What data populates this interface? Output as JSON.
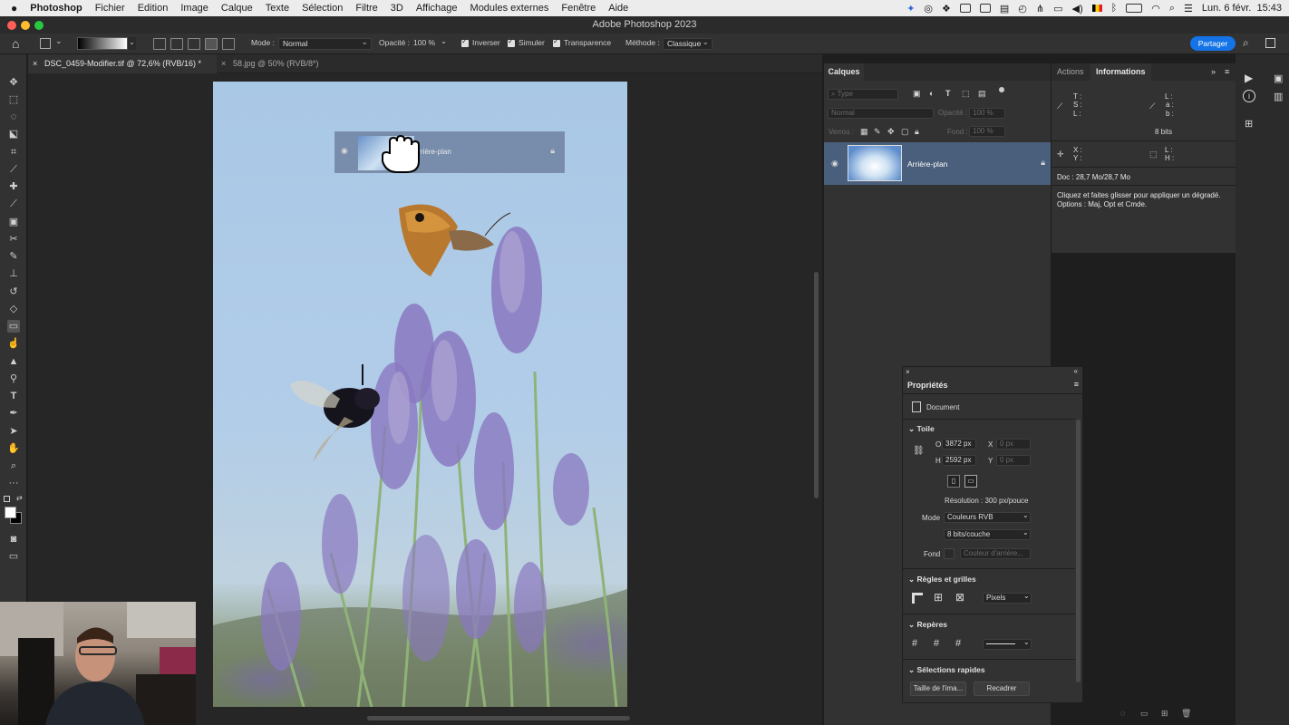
{
  "menubar": {
    "app": "Photoshop",
    "items": [
      "Fichier",
      "Edition",
      "Image",
      "Calque",
      "Texte",
      "Sélection",
      "Filtre",
      "3D",
      "Affichage",
      "Modules externes",
      "Fenêtre",
      "Aide"
    ],
    "clock": "Lun. 6 févr.  15:43"
  },
  "window": {
    "title": "Adobe Photoshop 2023"
  },
  "options": {
    "mode_label": "Mode :",
    "mode_value": "Normal",
    "opacity_label": "Opacité :",
    "opacity_value": "100 %",
    "inverse": "Inverser",
    "dither": "Simuler",
    "transparency": "Transparence",
    "method_label": "Méthode :",
    "method_value": "Classique",
    "share": "Partager"
  },
  "tabs": [
    {
      "label": "DSC_0459-Modifier.tif @ 72,6% (RVB/16) *",
      "active": true
    },
    {
      "label": "58.jpg @ 50% (RVB/8*)",
      "active": false
    }
  ],
  "drag": {
    "layer_label": "Arrière-plan"
  },
  "layers": {
    "title": "Calques",
    "filter_placeholder": "Type",
    "blend": "Normal",
    "opacity_label": "Opacité :",
    "opacity_value": "100 %",
    "lock_label": "Verrou :",
    "fill_label": "Fond :",
    "fill_value": "100 %",
    "layer_name": "Arrière-plan"
  },
  "info": {
    "tab_actions": "Actions",
    "tab_info": "Informations",
    "t": "T :",
    "s": "S :",
    "l": "L :",
    "L": "L :",
    "a": "a :",
    "b": "b :",
    "bits": "8 bits",
    "x": "X :",
    "y": "Y :",
    "w": "L :",
    "h": "H :",
    "doc": "Doc : 28,7 Mo/28,7 Mo",
    "hint1": "Cliquez et faites glisser pour appliquer un dégradé.",
    "hint2": "Options : Maj, Opt et Cmde."
  },
  "props": {
    "title": "Propriétés",
    "doc": "Document",
    "canvas_section": "Toile",
    "w_label": "O",
    "w_value": "3872 px",
    "h_label": "H",
    "h_value": "2592 px",
    "x_label": "X",
    "y_label": "Y",
    "xy_placeholder": "0 px",
    "resolution": "Résolution : 300 px/pouce",
    "mode_label": "Mode",
    "mode_value": "Couleurs RVB",
    "depth_value": "8 bits/couche",
    "bg_label": "Fond",
    "bg_value": "Couleur d'arrière...",
    "rulers_section": "Règles et grilles",
    "units": "Pixels",
    "guides_section": "Repères",
    "quick_section": "Sélections rapides",
    "btn_size": "Taille de l'ima...",
    "btn_crop": "Recadrer"
  }
}
